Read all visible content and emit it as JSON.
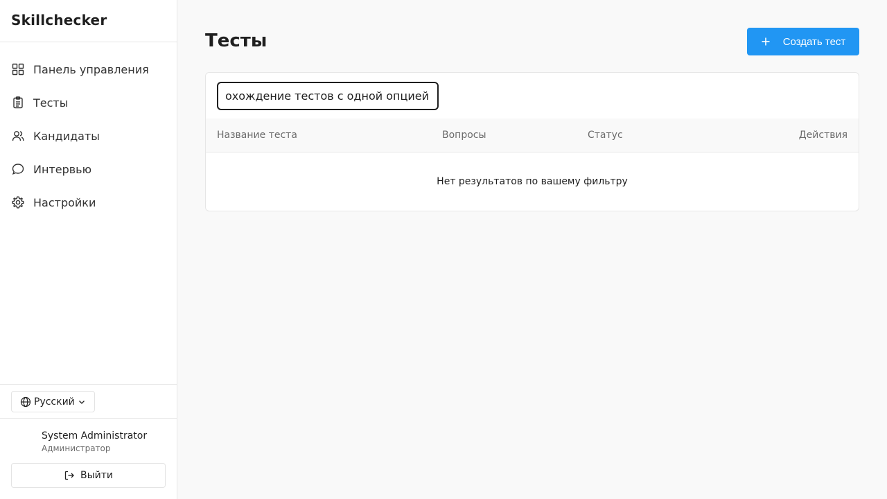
{
  "app": {
    "brand": "Skillchecker"
  },
  "sidebar": {
    "items": [
      {
        "label": "Панель управления",
        "icon": "dashboard-icon"
      },
      {
        "label": "Тесты",
        "icon": "clipboard-icon"
      },
      {
        "label": "Кандидаты",
        "icon": "users-icon"
      },
      {
        "label": "Интервью",
        "icon": "message-icon"
      },
      {
        "label": "Настройки",
        "icon": "gear-icon"
      }
    ],
    "language": {
      "label": "Русский",
      "icon": "globe-icon"
    },
    "user": {
      "name": "System Administrator",
      "role": "Администратор"
    },
    "logout_label": "Выйти"
  },
  "main": {
    "title": "Тесты",
    "create_label": "Создать тест",
    "search": {
      "value": "охождение тестов с одной опцией",
      "placeholder": ""
    },
    "table": {
      "columns": [
        "Название теста",
        "Вопросы",
        "Статус",
        "Действия"
      ],
      "rows": [],
      "empty_message": "Нет результатов по вашему фильтру"
    }
  },
  "colors": {
    "accent": "#2196f3",
    "text": "#1f1f1f",
    "muted": "#6b6b6b",
    "border": "#e6e6e6"
  }
}
